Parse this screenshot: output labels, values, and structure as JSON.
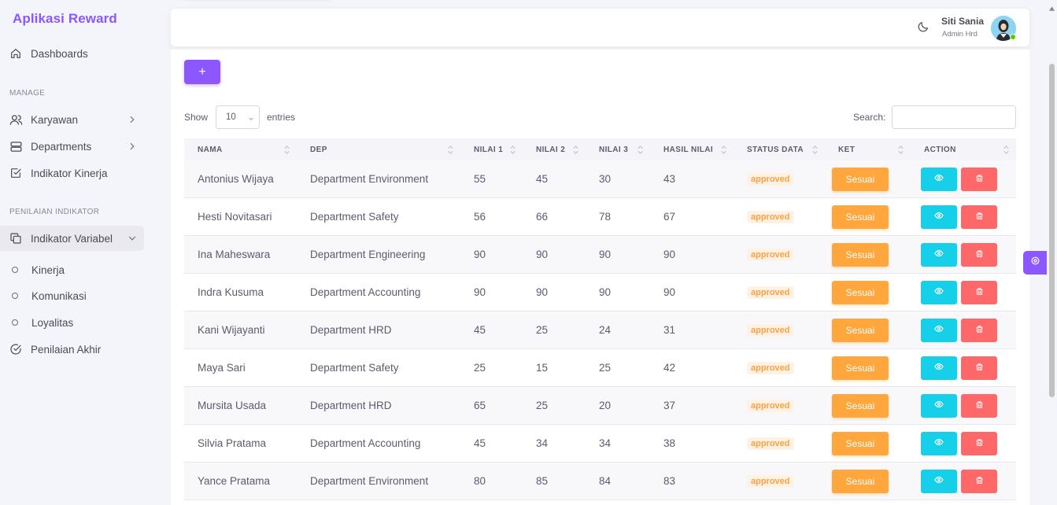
{
  "sidebar": {
    "brand": "Aplikasi Reward",
    "dashboard": "Dashboards",
    "section_manage": "MANAGE",
    "karyawan": "Karyawan",
    "departments": "Departments",
    "indikator_kinerja": "Indikator Kinerja",
    "section_penilaian": "PENILAIAN INDIKATOR",
    "indikator_variabel": "Indikator Variabel",
    "sub_items": [
      "Kinerja",
      "Komunikasi",
      "Loyalitas"
    ],
    "penilaian_akhir": "Penilaian Akhir"
  },
  "navbar": {
    "user_name": "Siti Sania",
    "user_role": "Admin Hrd"
  },
  "toolbar": {
    "add_label": "+",
    "show_label": "Show",
    "entries_value": "10",
    "entries_label": "entries",
    "search_label": "Search:",
    "search_value": ""
  },
  "table": {
    "headers": [
      "NAMA",
      "DEP",
      "NILAI 1",
      "NILAI 2",
      "NILAI 3",
      "HASIL NILAI",
      "STATUS DATA",
      "KET",
      "ACTION"
    ],
    "rows": [
      {
        "nama": "Antonius Wijaya",
        "dep": "Department Environment",
        "n1": "55",
        "n2": "45",
        "n3": "30",
        "hasil": "43",
        "status": "approved",
        "ket": "Sesuai"
      },
      {
        "nama": "Hesti Novitasari",
        "dep": "Department Safety",
        "n1": "56",
        "n2": "66",
        "n3": "78",
        "hasil": "67",
        "status": "approved",
        "ket": "Sesuai"
      },
      {
        "nama": "Ina Maheswara",
        "dep": "Department Engineering",
        "n1": "90",
        "n2": "90",
        "n3": "90",
        "hasil": "90",
        "status": "approved",
        "ket": "Sesuai"
      },
      {
        "nama": "Indra Kusuma",
        "dep": "Department Accounting",
        "n1": "90",
        "n2": "90",
        "n3": "90",
        "hasil": "90",
        "status": "approved",
        "ket": "Sesuai"
      },
      {
        "nama": "Kani Wijayanti",
        "dep": "Department HRD",
        "n1": "45",
        "n2": "25",
        "n3": "24",
        "hasil": "31",
        "status": "approved",
        "ket": "Sesuai"
      },
      {
        "nama": "Maya Sari",
        "dep": "Department Safety",
        "n1": "25",
        "n2": "15",
        "n3": "25",
        "hasil": "42",
        "status": "approved",
        "ket": "Sesuai"
      },
      {
        "nama": "Mursita Usada",
        "dep": "Department HRD",
        "n1": "65",
        "n2": "25",
        "n3": "20",
        "hasil": "37",
        "status": "approved",
        "ket": "Sesuai"
      },
      {
        "nama": "Silvia Pratama",
        "dep": "Department Accounting",
        "n1": "45",
        "n2": "34",
        "n3": "34",
        "hasil": "38",
        "status": "approved",
        "ket": "Sesuai"
      },
      {
        "nama": "Yance Pratama",
        "dep": "Department Environment",
        "n1": "80",
        "n2": "85",
        "n3": "84",
        "hasil": "83",
        "status": "approved",
        "ket": "Sesuai"
      }
    ]
  },
  "colors": {
    "primary": "#8c57ff",
    "warning": "#ffa63d",
    "info": "#16cfe8",
    "danger": "#ff5c5c",
    "success": "#56ca00"
  },
  "icons": {
    "dashboard": "home-icon",
    "karyawan": "users-icon",
    "departments": "server-icon",
    "indikator_kinerja": "checkbox-icon",
    "indikator_variabel": "copy-icon",
    "penilaian_akhir": "circle-check-icon",
    "theme": "moon-icon",
    "view": "eye-icon",
    "delete": "trash-icon",
    "customizer": "settings-icon"
  }
}
